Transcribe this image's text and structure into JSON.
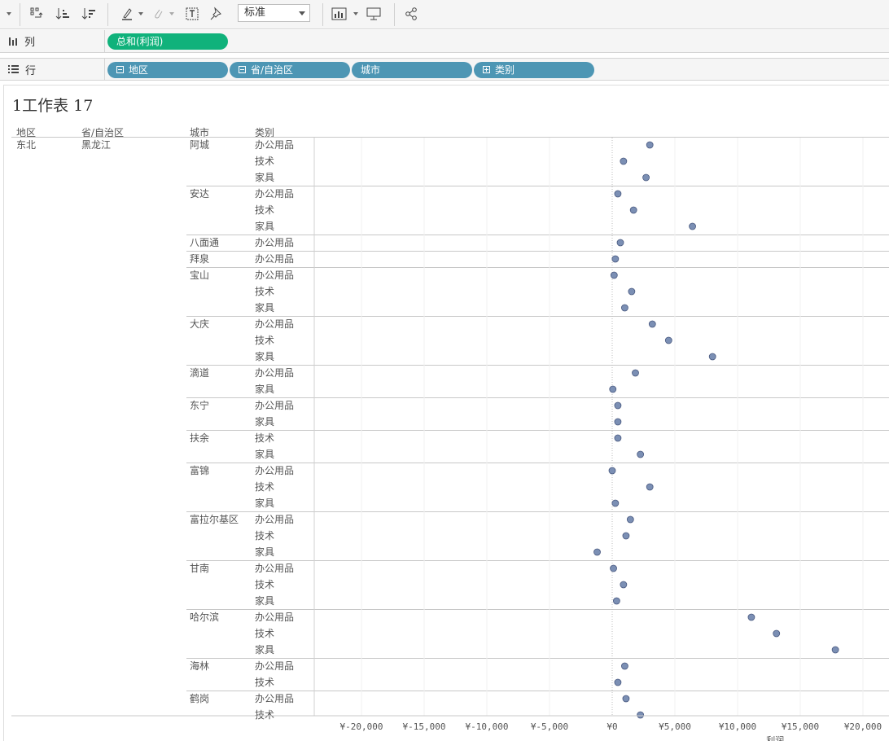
{
  "toolbar": {
    "icons": [
      "dropdown-icon",
      "swap-icon",
      "sort-asc-icon",
      "sort-desc-icon",
      "highlight-pen-icon",
      "paperclip-icon",
      "text-box-icon",
      "pin-icon",
      "show-me-icon",
      "presentation-icon",
      "share-icon"
    ],
    "fit_select": "标准"
  },
  "columns_shelf": {
    "label": "列",
    "pills": [
      {
        "text": "总和(利润)",
        "color": "#10b27b"
      }
    ]
  },
  "rows_shelf": {
    "label": "行",
    "pills": [
      {
        "text": "地区",
        "box": "minus"
      },
      {
        "text": "省/自治区",
        "box": "minus"
      },
      {
        "text": "城市",
        "box": "none"
      },
      {
        "text": "类别",
        "box": "plus"
      }
    ]
  },
  "sheet": {
    "title": "1工作表  17",
    "headers": [
      "地区",
      "省/自治区",
      "城市",
      "类别"
    ],
    "region": "东北",
    "province": "黑龙江"
  },
  "chart_data": {
    "type": "scatter",
    "xlabel": "利润",
    "xlim": [
      -22500,
      22000
    ],
    "ticks": [
      -20000,
      -15000,
      -10000,
      -5000,
      0,
      5000,
      10000,
      15000,
      20000
    ],
    "tick_labels": [
      "¥-20,000",
      "¥-15,000",
      "¥-10,000",
      "¥-5,000",
      "¥0",
      "¥5,000",
      "¥10,000",
      "¥15,000",
      "¥20,000"
    ],
    "point_color": "#7b8fb4",
    "cities": [
      {
        "city": "阿城",
        "rows": [
          {
            "cat": "办公用品",
            "v": 3000
          },
          {
            "cat": "技术",
            "v": 900
          },
          {
            "cat": "家具",
            "v": 2700
          }
        ]
      },
      {
        "city": "安达",
        "rows": [
          {
            "cat": "办公用品",
            "v": 450
          },
          {
            "cat": "技术",
            "v": 1700
          },
          {
            "cat": "家具",
            "v": 6400
          }
        ]
      },
      {
        "city": "八面通",
        "rows": [
          {
            "cat": "办公用品",
            "v": 650
          }
        ]
      },
      {
        "city": "拜泉",
        "rows": [
          {
            "cat": "办公用品",
            "v": 250
          }
        ]
      },
      {
        "city": "宝山",
        "rows": [
          {
            "cat": "办公用品",
            "v": 150
          },
          {
            "cat": "技术",
            "v": 1550
          },
          {
            "cat": "家具",
            "v": 1000
          }
        ]
      },
      {
        "city": "大庆",
        "rows": [
          {
            "cat": "办公用品",
            "v": 3200
          },
          {
            "cat": "技术",
            "v": 4500
          },
          {
            "cat": "家具",
            "v": 8000
          }
        ]
      },
      {
        "city": "滴道",
        "rows": [
          {
            "cat": "办公用品",
            "v": 1850
          },
          {
            "cat": "家具",
            "v": 50
          }
        ]
      },
      {
        "city": "东宁",
        "rows": [
          {
            "cat": "办公用品",
            "v": 450
          },
          {
            "cat": "家具",
            "v": 450
          }
        ]
      },
      {
        "city": "扶余",
        "rows": [
          {
            "cat": "技术",
            "v": 450
          },
          {
            "cat": "家具",
            "v": 2250
          }
        ]
      },
      {
        "city": "富锦",
        "rows": [
          {
            "cat": "办公用品",
            "v": 0
          },
          {
            "cat": "技术",
            "v": 3000
          },
          {
            "cat": "家具",
            "v": 250
          }
        ]
      },
      {
        "city": "富拉尔基区",
        "rows": [
          {
            "cat": "办公用品",
            "v": 1450
          },
          {
            "cat": "技术",
            "v": 1100
          },
          {
            "cat": "家具",
            "v": -1200
          }
        ]
      },
      {
        "city": "甘南",
        "rows": [
          {
            "cat": "办公用品",
            "v": 100
          },
          {
            "cat": "技术",
            "v": 900
          },
          {
            "cat": "家具",
            "v": 350
          }
        ]
      },
      {
        "city": "哈尔滨",
        "rows": [
          {
            "cat": "办公用品",
            "v": 11100
          },
          {
            "cat": "技术",
            "v": 13100
          },
          {
            "cat": "家具",
            "v": 17800
          }
        ]
      },
      {
        "city": "海林",
        "rows": [
          {
            "cat": "办公用品",
            "v": 1000
          },
          {
            "cat": "技术",
            "v": 450
          }
        ]
      },
      {
        "city": "鹤岗",
        "rows": [
          {
            "cat": "办公用品",
            "v": 1100
          },
          {
            "cat": "技术",
            "v": 2250
          }
        ]
      }
    ]
  }
}
